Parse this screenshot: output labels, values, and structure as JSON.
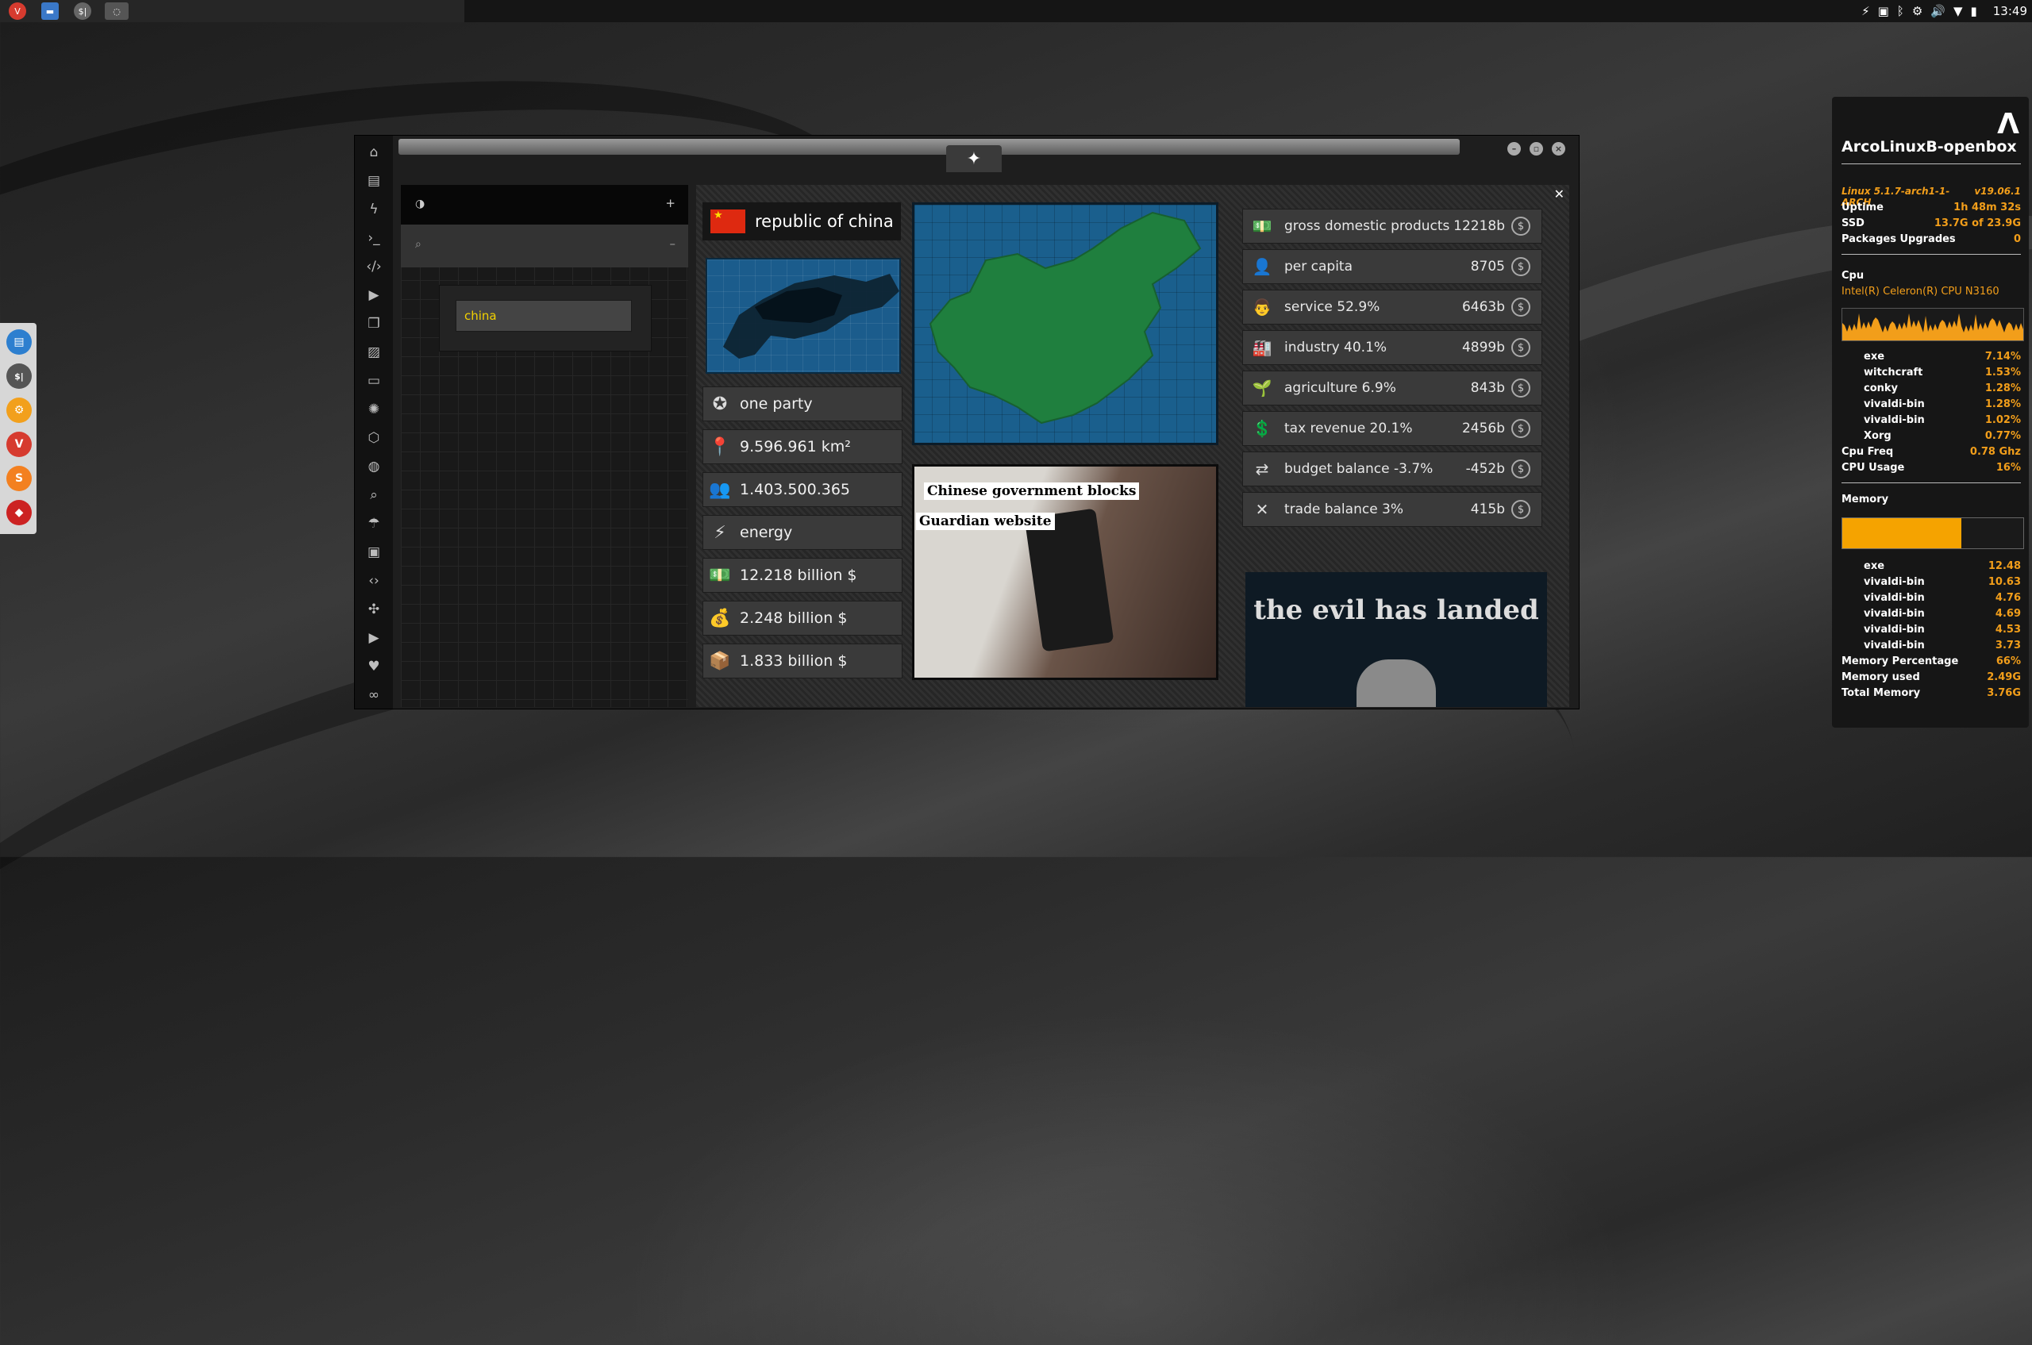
{
  "topbar": {
    "apps": [
      {
        "icon": "vivaldi-icon",
        "color": "#d63b2f"
      },
      {
        "icon": "folder-icon",
        "color": "#3a78c8"
      },
      {
        "icon": "terminal-icon",
        "label": "$|",
        "color": "#666"
      },
      {
        "icon": "app-icon",
        "color": "#555"
      }
    ],
    "tray": [
      "power-icon",
      "screenshot-icon",
      "bluetooth-icon",
      "settings-icon",
      "volume-icon",
      "wifi-icon",
      "battery-icon"
    ],
    "clock": "13:49"
  },
  "dock": {
    "items": [
      {
        "icon": "files-icon",
        "color": "#2d7fcf"
      },
      {
        "icon": "terminal-icon",
        "label": "$|",
        "color": "#555"
      },
      {
        "icon": "settings-icon",
        "color": "#f2a01c"
      },
      {
        "icon": "vivaldi-icon",
        "label": "V",
        "color": "#d63b2f"
      },
      {
        "icon": "sublime-icon",
        "label": "S",
        "color": "#f38020"
      },
      {
        "icon": "ruby-icon",
        "color": "#cc2222"
      }
    ]
  },
  "search_panel": {
    "search_value": "china"
  },
  "country": {
    "name": "republic of china",
    "facts": [
      {
        "icon": "government-icon",
        "glyph": "✪",
        "text": "one party"
      },
      {
        "icon": "area-icon",
        "glyph": "📍",
        "text": "9.596.961 km²"
      },
      {
        "icon": "population-icon",
        "glyph": "👥",
        "text": "1.403.500.365"
      },
      {
        "icon": "energy-icon",
        "glyph": "⚡",
        "text": "energy"
      },
      {
        "icon": "money-icon",
        "glyph": "💵",
        "text": "12.218 billion $"
      },
      {
        "icon": "money-stack-icon",
        "glyph": "💰",
        "text": "2.248 billion $"
      },
      {
        "icon": "box-icon",
        "glyph": "📦",
        "text": "1.833 billion $"
      }
    ]
  },
  "economy": [
    {
      "icon": "gdp-icon",
      "glyph": "💵",
      "label": "gross domestic products",
      "value": "12218b"
    },
    {
      "icon": "person-icon",
      "glyph": "👤",
      "label": "per capita",
      "value": "8705"
    },
    {
      "icon": "chef-icon",
      "glyph": "👨",
      "label": "service 52.9%",
      "value": "6463b"
    },
    {
      "icon": "factory-icon",
      "glyph": "🏭",
      "label": "industry 40.1%",
      "value": "4899b"
    },
    {
      "icon": "plant-icon",
      "glyph": "🌱",
      "label": "agriculture 6.9%",
      "value": "843b"
    },
    {
      "icon": "tax-icon",
      "glyph": "💲",
      "label": "tax revenue 20.1%",
      "value": "2456b"
    },
    {
      "icon": "exchange-icon",
      "glyph": "⇄",
      "label": "budget balance -3.7%",
      "value": "-452b"
    },
    {
      "icon": "trade-icon",
      "glyph": "✕",
      "label": "trade balance 3%",
      "value": "415b"
    }
  ],
  "news": {
    "line1": "Chinese government blocks",
    "line2": "Guardian website"
  },
  "poster": {
    "title": "the evil has landed"
  },
  "conky": {
    "hostname": "ArcoLinuxB-openbox",
    "kernel": "Linux 5.1.7-arch1-1-ARCH",
    "version": "v19.06.1",
    "uptime_label": "Uptime",
    "uptime": "1h 48m 32s",
    "ssd_label": "SSD",
    "ssd": "13.7G of 23.9G",
    "pkg_label": "Packages Upgrades",
    "pkg": "0",
    "cpu_label": "Cpu",
    "cpu_model": "Intel(R) Celeron(R) CPU  N3160",
    "cpu_procs": [
      {
        "name": "exe",
        "val": "7.14%"
      },
      {
        "name": "witchcraft",
        "val": "1.53%"
      },
      {
        "name": "conky",
        "val": "1.28%"
      },
      {
        "name": "vivaldi-bin",
        "val": "1.28%"
      },
      {
        "name": "vivaldi-bin",
        "val": "1.02%"
      },
      {
        "name": "Xorg",
        "val": "0.77%"
      }
    ],
    "cpufreq_label": "Cpu Freq",
    "cpufreq": "0.78 Ghz",
    "cpuusage_label": "CPU Usage",
    "cpuusage": "16%",
    "mem_label": "Memory",
    "mem_fraction": 0.66,
    "mem_procs": [
      {
        "name": "exe",
        "val": "12.48"
      },
      {
        "name": "vivaldi-bin",
        "val": "10.63"
      },
      {
        "name": "vivaldi-bin",
        "val": "4.76"
      },
      {
        "name": "vivaldi-bin",
        "val": "4.69"
      },
      {
        "name": "vivaldi-bin",
        "val": "4.53"
      },
      {
        "name": "vivaldi-bin",
        "val": "3.73"
      }
    ],
    "mempct_label": "Memory Percentage",
    "mempct": "66%",
    "memused_label": "Memory used",
    "memused": "2.49G",
    "memtotal_label": "Total Memory",
    "memtotal": "3.76G",
    "accent": "#f29e1a"
  }
}
